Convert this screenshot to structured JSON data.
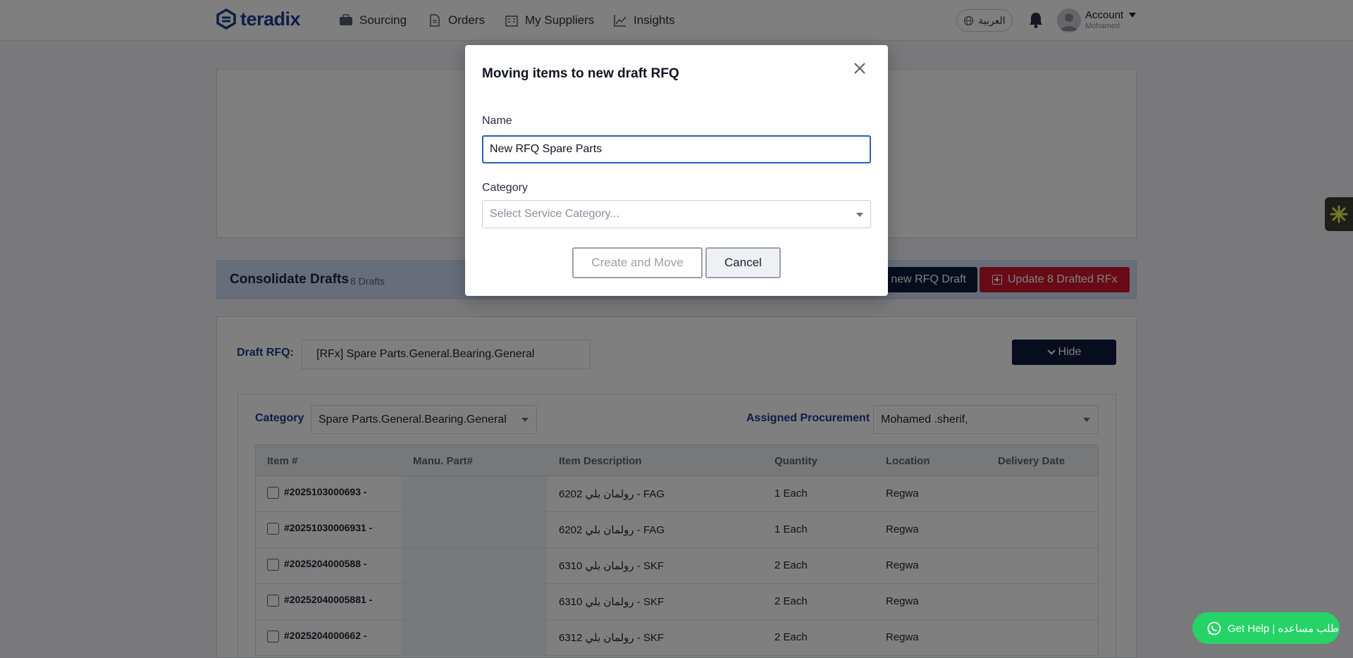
{
  "nav": {
    "logo_text": "teradix",
    "links": [
      {
        "label": "Sourcing",
        "icon": "sourcing-icon"
      },
      {
        "label": "Orders",
        "icon": "orders-icon"
      },
      {
        "label": "My Suppliers",
        "icon": "suppliers-icon"
      },
      {
        "label": "Insights",
        "icon": "insights-icon"
      }
    ],
    "language_label": "العربية",
    "account_label": "Account",
    "account_user": "Mohamed"
  },
  "consolidate": {
    "title": "Consolidate Drafts",
    "count": "8 Drafts",
    "new_draft_label": "new RFQ Draft",
    "update_label": "Update 8 Drafted RFx"
  },
  "draft": {
    "label": "Draft RFQ:",
    "value": "[RFx] Spare Parts.General.Bearing.General",
    "hide_label": "Hide",
    "category_label": "Category",
    "category_value": "Spare Parts.General.Bearing.General",
    "procurement_label": "Assigned Procurement",
    "procurement_value": "Mohamed .sherif,"
  },
  "table": {
    "headers": [
      "Item #",
      "Manu. Part#",
      "Item Description",
      "Quantity",
      "Location",
      "Delivery Date"
    ],
    "rows": [
      {
        "item": "#2025103000693 -",
        "manu": "",
        "desc": "6202 رولمان بلي - FAG",
        "qty": "1 Each",
        "location": "Regwa",
        "date": ""
      },
      {
        "item": "#20251030006931 -",
        "manu": "",
        "desc": "6202 رولمان بلي - FAG",
        "qty": "1 Each",
        "location": "Regwa",
        "date": ""
      },
      {
        "item": "#2025204000588 -",
        "manu": "",
        "desc": "6310 رولمان بلي - SKF",
        "qty": "2 Each",
        "location": "Regwa",
        "date": ""
      },
      {
        "item": "#20252040005881 -",
        "manu": "",
        "desc": "6310 رولمان بلي - SKF",
        "qty": "2 Each",
        "location": "Regwa",
        "date": ""
      },
      {
        "item": "#2025204000662 -",
        "manu": "",
        "desc": "6312 رولمان بلي - SKF",
        "qty": "2 Each",
        "location": "Regwa",
        "date": ""
      }
    ]
  },
  "modal": {
    "title": "Moving items to new draft RFQ",
    "name_label": "Name",
    "name_value": "New RFQ Spare Parts",
    "category_label": "Category",
    "category_placeholder": "Select Service Category...",
    "create_label": "Create and Move",
    "cancel_label": "Cancel"
  },
  "help": {
    "label": "Get Help | طلب مساعده"
  },
  "colors": {
    "brand": "#1d3c8f",
    "dark_button": "#0e1a3a",
    "danger": "#d0142a",
    "whatsapp": "#25d366",
    "focus_border": "#2f5fb3"
  }
}
